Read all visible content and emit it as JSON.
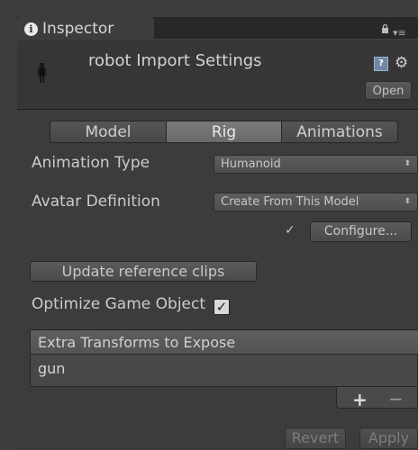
{
  "tab": {
    "title": "Inspector",
    "info_icon": "i"
  },
  "header": {
    "title": "robot Import Settings",
    "help_icon": "?",
    "open_label": "Open"
  },
  "tabs": [
    "Model",
    "Rig",
    "Animations"
  ],
  "active_tab": "Rig",
  "animation_type": {
    "label": "Animation Type",
    "value": "Humanoid"
  },
  "avatar_definition": {
    "label": "Avatar Definition",
    "value": "Create From This Model"
  },
  "configure": {
    "check": "✓",
    "label": "Configure..."
  },
  "update_button": "Update reference clips",
  "optimize": {
    "label": "Optimize Game Object",
    "checked": true,
    "check_glyph": "✓"
  },
  "extra_transforms": {
    "header": "Extra Transforms to Expose",
    "items": [
      "gun"
    ]
  },
  "list_controls": {
    "plus": "+",
    "minus": "−"
  },
  "footer": {
    "revert_label": "Revert",
    "apply_label": "Apply"
  },
  "icons": {
    "gear": "⚙",
    "arrow": "⬍",
    "menu": "▾≡"
  }
}
